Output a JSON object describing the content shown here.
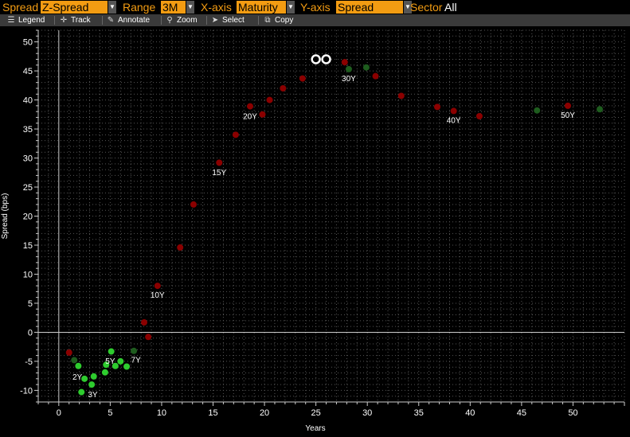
{
  "topbar": {
    "spread_label": "Spread",
    "spread_value": "Z-Spread",
    "range_label": "Range",
    "range_value": "3M",
    "xaxis_label": "X-axis",
    "xaxis_value": "Maturity",
    "yaxis_label": "Y-axis",
    "yaxis_value": "Spread",
    "sector_label": "Sector",
    "sector_value": "All",
    "dropdown_arrow": "▼"
  },
  "toolbar": {
    "legend": "Legend",
    "track": "Track",
    "annotate": "Annotate",
    "zoom": "Zoom",
    "select": "Select",
    "copy": "Copy"
  },
  "colors": {
    "background": "#000000",
    "accent": "#f39c12",
    "dark_red": "#8b0000",
    "dark_green": "#1e5c1e",
    "bright_green": "#2ecc2e",
    "grid": "#555555",
    "zero_line": "#cccccc"
  },
  "chart_data": {
    "type": "scatter",
    "title": "",
    "xlabel": "Years",
    "ylabel": "Spread (bps)",
    "xlim": [
      -2,
      55
    ],
    "ylim": [
      -12,
      52
    ],
    "x_ticks": [
      0,
      5,
      10,
      15,
      20,
      25,
      30,
      35,
      40,
      45,
      50
    ],
    "y_ticks": [
      -10,
      -5,
      0,
      5,
      10,
      15,
      20,
      25,
      30,
      35,
      40,
      45,
      50
    ],
    "grid": true,
    "legend": "none",
    "series": [
      {
        "color": "#8b0000",
        "points": [
          {
            "x": 1.0,
            "y": -3.5
          },
          {
            "x": 8.3,
            "y": 1.7
          },
          {
            "x": 8.7,
            "y": -0.8
          },
          {
            "x": 9.6,
            "y": 8.0
          },
          {
            "x": 11.8,
            "y": 14.6
          },
          {
            "x": 13.1,
            "y": 22.0
          },
          {
            "x": 15.6,
            "y": 29.2
          },
          {
            "x": 17.2,
            "y": 34.0
          },
          {
            "x": 18.6,
            "y": 38.9
          },
          {
            "x": 19.8,
            "y": 37.5
          },
          {
            "x": 20.5,
            "y": 40.0
          },
          {
            "x": 21.8,
            "y": 42.0
          },
          {
            "x": 23.7,
            "y": 43.7
          },
          {
            "x": 27.8,
            "y": 46.5
          },
          {
            "x": 30.8,
            "y": 44.1
          },
          {
            "x": 33.3,
            "y": 40.7
          },
          {
            "x": 36.8,
            "y": 38.8
          },
          {
            "x": 38.4,
            "y": 38.1
          },
          {
            "x": 40.9,
            "y": 37.2
          },
          {
            "x": 49.5,
            "y": 39.0
          }
        ]
      },
      {
        "color": "#1e5c1e",
        "points": [
          {
            "x": 1.5,
            "y": -4.8
          },
          {
            "x": 7.3,
            "y": -3.2
          },
          {
            "x": 28.2,
            "y": 45.3
          },
          {
            "x": 29.9,
            "y": 45.6
          },
          {
            "x": 46.5,
            "y": 38.2
          },
          {
            "x": 52.6,
            "y": 38.4
          }
        ]
      },
      {
        "color": "#2ecc2e",
        "points": [
          {
            "x": 1.9,
            "y": -5.8
          },
          {
            "x": 2.2,
            "y": -10.3
          },
          {
            "x": 2.5,
            "y": -8.0
          },
          {
            "x": 3.2,
            "y": -9.0
          },
          {
            "x": 3.4,
            "y": -7.6
          },
          {
            "x": 4.5,
            "y": -6.9
          },
          {
            "x": 4.6,
            "y": -5.6
          },
          {
            "x": 5.1,
            "y": -3.3
          },
          {
            "x": 5.5,
            "y": -5.8
          },
          {
            "x": 6.0,
            "y": -5.0
          },
          {
            "x": 6.6,
            "y": -5.9
          }
        ]
      },
      {
        "color": "#ffffff",
        "style": "ring",
        "points": [
          {
            "x": 25.0,
            "y": 47.0
          },
          {
            "x": 26.0,
            "y": 47.0
          }
        ]
      }
    ],
    "annotations": [
      {
        "text": "2Y",
        "x": 1.8,
        "y": -7.6
      },
      {
        "text": "3Y",
        "x": 3.3,
        "y": -10.6
      },
      {
        "text": "5Y",
        "x": 5.0,
        "y": -4.9
      },
      {
        "text": "7Y",
        "x": 7.5,
        "y": -4.7
      },
      {
        "text": "10Y",
        "x": 9.6,
        "y": 6.5
      },
      {
        "text": "15Y",
        "x": 15.6,
        "y": 27.6
      },
      {
        "text": "20Y",
        "x": 18.6,
        "y": 37.3
      },
      {
        "text": "30Y",
        "x": 28.2,
        "y": 43.8
      },
      {
        "text": "40Y",
        "x": 38.4,
        "y": 36.6
      },
      {
        "text": "50Y",
        "x": 49.5,
        "y": 37.5
      }
    ]
  }
}
